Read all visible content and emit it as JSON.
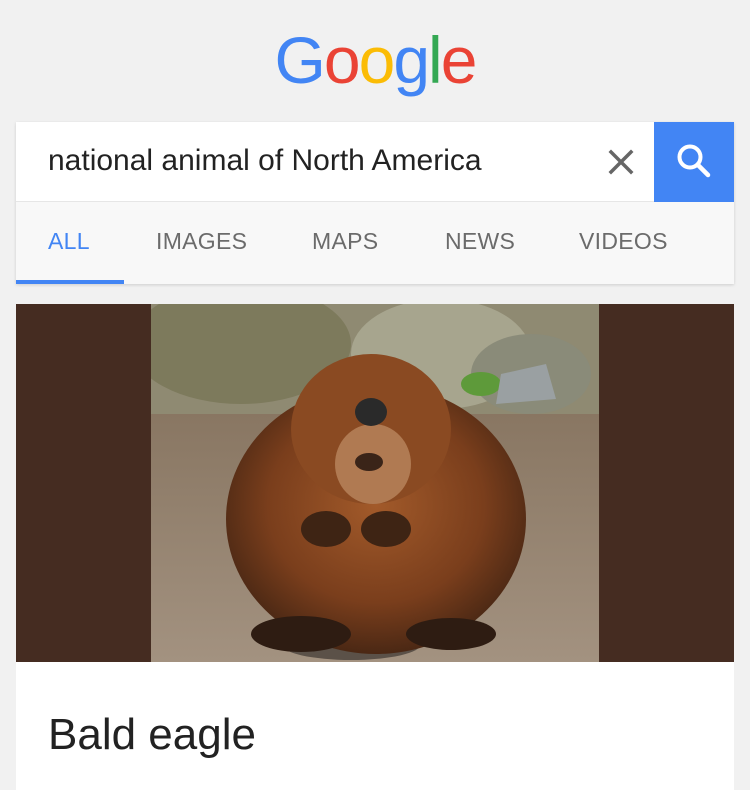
{
  "logo": {
    "letters": [
      "G",
      "o",
      "o",
      "g",
      "l",
      "e"
    ],
    "colors": [
      "#4285f4",
      "#ea4335",
      "#fbbc05",
      "#4285f4",
      "#34a853",
      "#ea4335"
    ]
  },
  "search": {
    "query": "national animal of North America",
    "clear_icon": "close-icon",
    "search_icon": "search-icon"
  },
  "tabs": [
    {
      "label": "ALL",
      "active": true
    },
    {
      "label": "IMAGES",
      "active": false
    },
    {
      "label": "MAPS",
      "active": false
    },
    {
      "label": "NEWS",
      "active": false
    },
    {
      "label": "VIDEOS",
      "active": false
    }
  ],
  "result": {
    "title": "Bald eagle"
  },
  "colors": {
    "accent": "#4285f4",
    "image_background": "#452c21"
  }
}
